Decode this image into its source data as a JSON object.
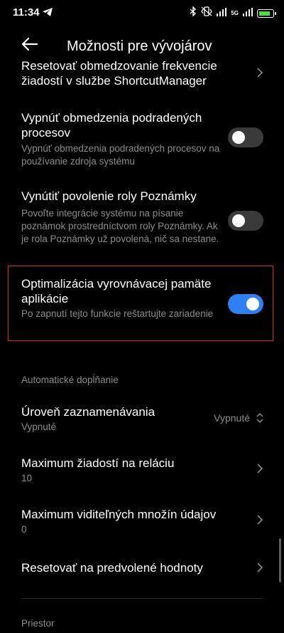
{
  "status": {
    "time": "11:34",
    "network": "5G",
    "battery_color": "#52d64b",
    "battery_level": 0.75
  },
  "header": {
    "title": "Možnosti pre vývojárov"
  },
  "items": [
    {
      "title": "Resetovať obmedzovanie frekvencie žiadostí v službe ShortcutManager",
      "subtitle": ""
    },
    {
      "title": "Vypnúť obmedzenia podradených procesov",
      "subtitle": "Vypnúť obmedzenia podradených procesov na používanie zdroja systému",
      "state": "off"
    },
    {
      "title": "Vynútiť povolenie roly Poznámky",
      "subtitle": "Povoľte integrácie systému na písanie poznámok prostredníctvom roly Poznámky. Ak je rola Poznámky už povolená, nič sa nestane.",
      "state": "off"
    },
    {
      "title": "Optimalizácia vyrovnávacej pamäte aplikácie",
      "subtitle": "Po zapnutí tejto funkcie reštartujte zariadenie",
      "state": "on"
    }
  ],
  "section_autofill": "Automatické dopĺňanie",
  "logging": {
    "title": "Úroveň zaznamenávania",
    "subtitle": "Vypnuté",
    "value": "Vypnuté"
  },
  "max_requests": {
    "title": "Maximum žiadostí na reláciu",
    "subtitle": "10"
  },
  "max_datasets": {
    "title": "Maximum viditeľných množín údajov",
    "subtitle": "0"
  },
  "reset_defaults": {
    "title": "Resetovať na predvolené hodnoty"
  },
  "section_space": "Priestor",
  "colors": {
    "toggle_on": "#2f80f5",
    "highlight": "#e52222"
  }
}
